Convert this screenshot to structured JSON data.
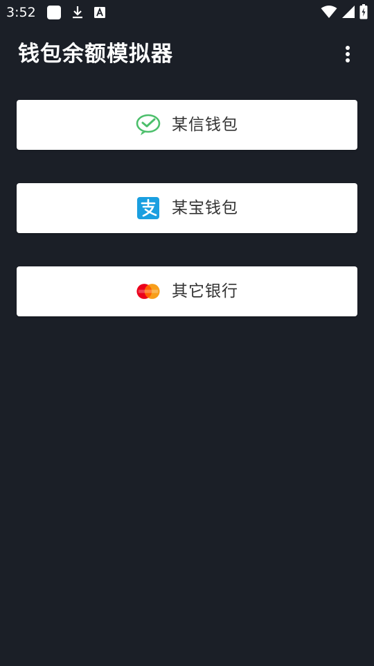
{
  "status_bar": {
    "time": "3:52",
    "icons": [
      "app-notification-icon",
      "download-icon",
      "font-icon",
      "wifi-icon",
      "signal-icon",
      "battery-charging-icon"
    ],
    "text_color": "#ffffff"
  },
  "app_bar": {
    "title": "钱包余额模拟器",
    "menu_icon": "more-vert-icon"
  },
  "wallets": [
    {
      "label": "某信钱包",
      "icon": "wechat-pay-icon",
      "accent": "#4cbf6b"
    },
    {
      "label": "某宝钱包",
      "icon": "alipay-icon",
      "accent": "#1a9fe0"
    },
    {
      "label": "其它银行",
      "icon": "mastercard-icon",
      "accent": "#eb001b"
    }
  ],
  "colors": {
    "background": "#1b1f27",
    "button_background": "#ffffff",
    "button_text": "#333333"
  }
}
